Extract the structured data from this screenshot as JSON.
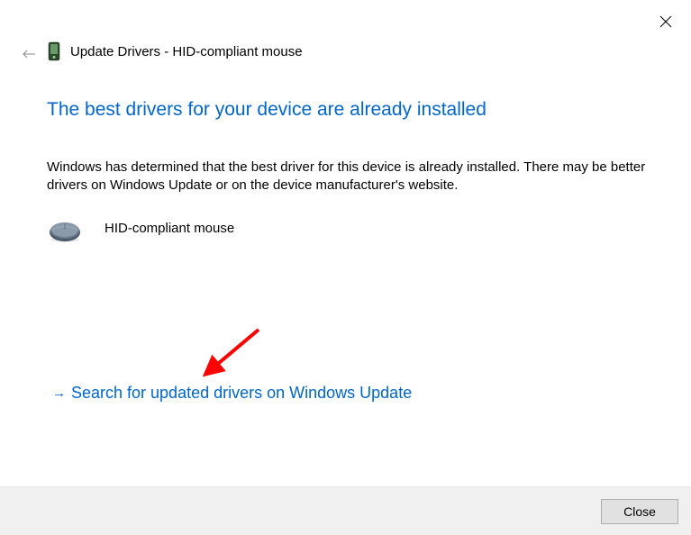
{
  "window": {
    "title": "Update Drivers - HID-compliant mouse",
    "close_icon": "close"
  },
  "heading": "The best drivers for your device are already installed",
  "description": "Windows has determined that the best driver for this device is already installed. There may be better drivers on Windows Update or on the device manufacturer's website.",
  "device": {
    "name": "HID-compliant mouse"
  },
  "link": {
    "arrow": "→",
    "text": "Search for updated drivers on Windows Update"
  },
  "footer": {
    "close_label": "Close"
  },
  "colors": {
    "accent": "#0066cc",
    "annotation": "#ff0000"
  }
}
